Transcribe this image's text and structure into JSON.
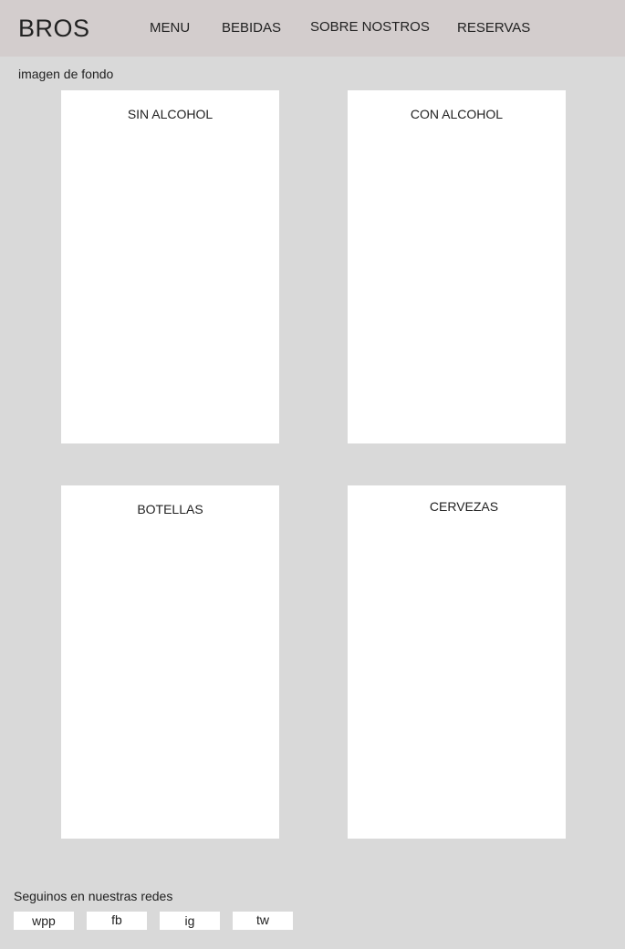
{
  "header": {
    "logo": "BROS",
    "nav": [
      {
        "label": "MENU"
      },
      {
        "label": "BEBIDAS"
      },
      {
        "label": "SOBRE NOSTROS"
      },
      {
        "label": "RESERVAS"
      }
    ],
    "background_color": "#d3cdcd"
  },
  "hero": {
    "label": "imagen de fondo"
  },
  "categories": [
    {
      "title": "SIN ALCOHOL"
    },
    {
      "title": "CON ALCOHOL"
    },
    {
      "title": "BOTELLAS"
    },
    {
      "title": "CERVEZAS"
    }
  ],
  "footer": {
    "social_label": "Seguinos en nuestras redes",
    "social_links": [
      {
        "label": "wpp"
      },
      {
        "label": "fb"
      },
      {
        "label": "ig"
      },
      {
        "label": "tw"
      }
    ]
  },
  "colors": {
    "page_background": "#d9d9d9",
    "card_background": "#ffffff",
    "text": "#222222"
  }
}
